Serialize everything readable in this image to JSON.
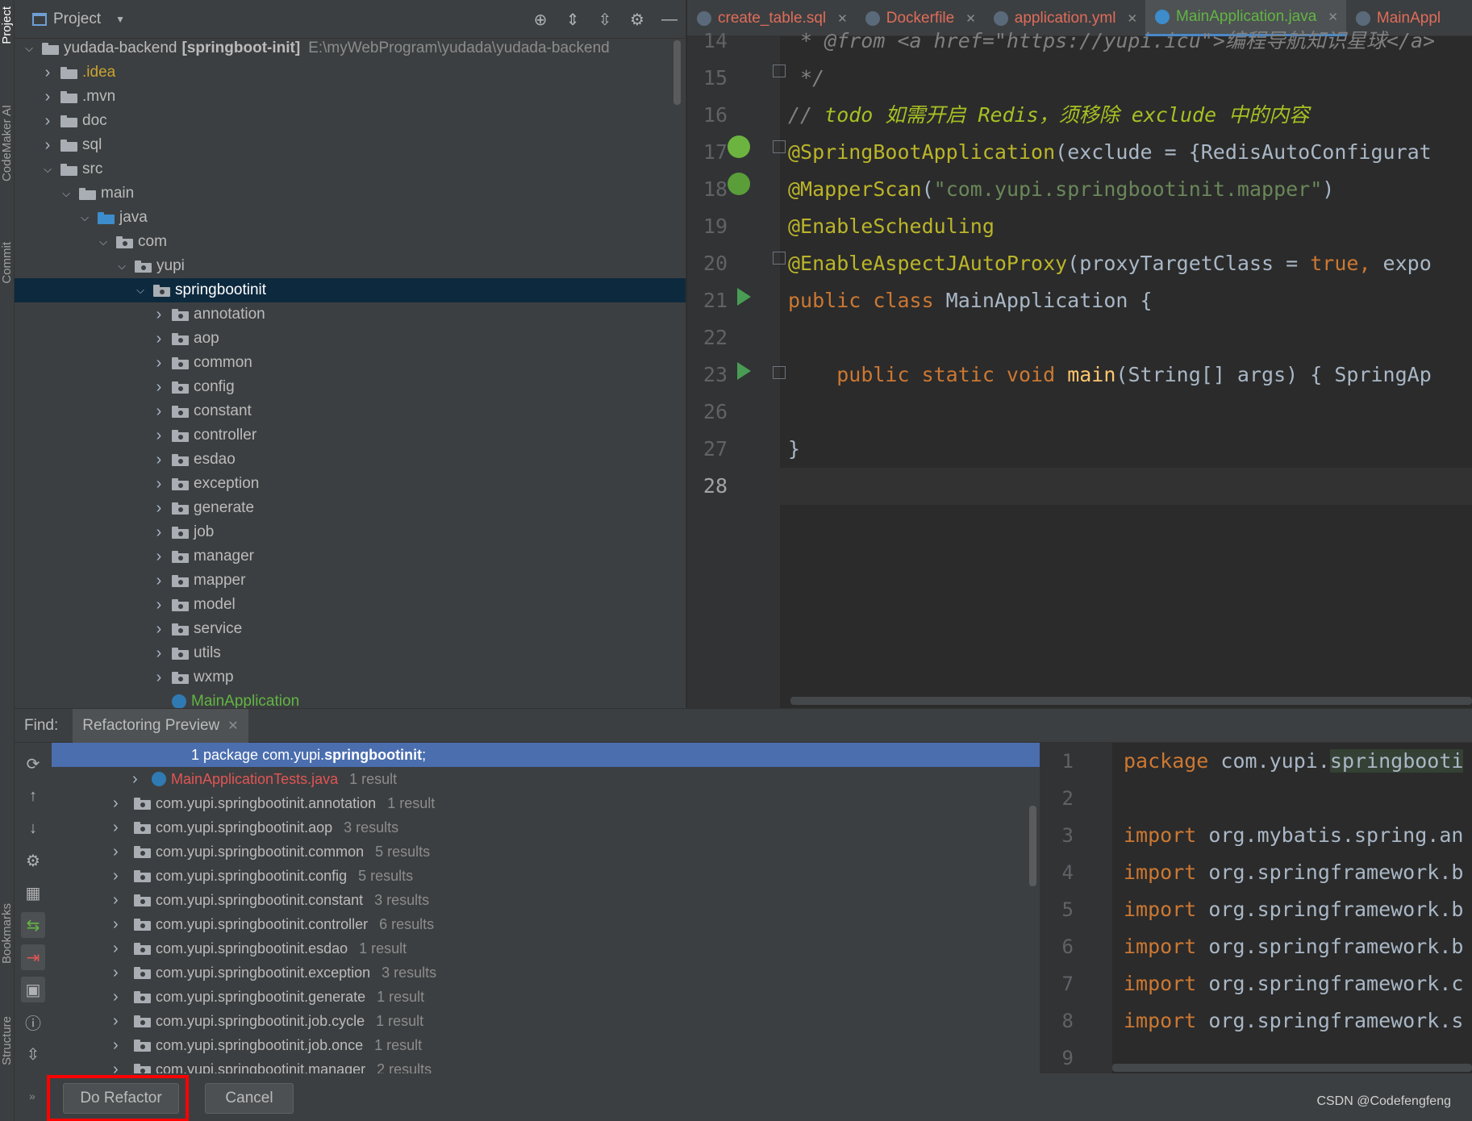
{
  "stripe": {
    "project_label": "Project",
    "codemaker_label": "CodeMaker AI",
    "commit_label": "Commit",
    "bookmarks_label": "Bookmarks",
    "structure_label": "Structure"
  },
  "project_panel": {
    "title": "Project",
    "root_name": "yudada-backend",
    "root_module": "[springboot-init]",
    "root_path": "E:\\myWebProgram\\yudada\\yudada-backend",
    "tree": [
      {
        "label": ".idea",
        "indent": 1,
        "expanded": false,
        "kind": "folder",
        "style": "yellow"
      },
      {
        "label": ".mvn",
        "indent": 1,
        "expanded": false,
        "kind": "folder"
      },
      {
        "label": "doc",
        "indent": 1,
        "expanded": false,
        "kind": "folder"
      },
      {
        "label": "sql",
        "indent": 1,
        "expanded": false,
        "kind": "folder"
      },
      {
        "label": "src",
        "indent": 1,
        "expanded": true,
        "kind": "folder"
      },
      {
        "label": "main",
        "indent": 2,
        "expanded": true,
        "kind": "folder"
      },
      {
        "label": "java",
        "indent": 3,
        "expanded": true,
        "kind": "folder-blue"
      },
      {
        "label": "com",
        "indent": 4,
        "expanded": true,
        "kind": "package"
      },
      {
        "label": "yupi",
        "indent": 5,
        "expanded": true,
        "kind": "package"
      },
      {
        "label": "springbootinit",
        "indent": 6,
        "expanded": true,
        "kind": "package",
        "selected": true
      },
      {
        "label": "annotation",
        "indent": 7,
        "expanded": false,
        "kind": "package"
      },
      {
        "label": "aop",
        "indent": 7,
        "expanded": false,
        "kind": "package"
      },
      {
        "label": "common",
        "indent": 7,
        "expanded": false,
        "kind": "package"
      },
      {
        "label": "config",
        "indent": 7,
        "expanded": false,
        "kind": "package"
      },
      {
        "label": "constant",
        "indent": 7,
        "expanded": false,
        "kind": "package"
      },
      {
        "label": "controller",
        "indent": 7,
        "expanded": false,
        "kind": "package"
      },
      {
        "label": "esdao",
        "indent": 7,
        "expanded": false,
        "kind": "package"
      },
      {
        "label": "exception",
        "indent": 7,
        "expanded": false,
        "kind": "package"
      },
      {
        "label": "generate",
        "indent": 7,
        "expanded": false,
        "kind": "package"
      },
      {
        "label": "job",
        "indent": 7,
        "expanded": false,
        "kind": "package"
      },
      {
        "label": "manager",
        "indent": 7,
        "expanded": false,
        "kind": "package"
      },
      {
        "label": "mapper",
        "indent": 7,
        "expanded": false,
        "kind": "package"
      },
      {
        "label": "model",
        "indent": 7,
        "expanded": false,
        "kind": "package"
      },
      {
        "label": "service",
        "indent": 7,
        "expanded": false,
        "kind": "package"
      },
      {
        "label": "utils",
        "indent": 7,
        "expanded": false,
        "kind": "package"
      },
      {
        "label": "wxmp",
        "indent": 7,
        "expanded": false,
        "kind": "package"
      },
      {
        "label": "MainApplication",
        "indent": 7,
        "expanded": null,
        "kind": "class",
        "style": "green"
      }
    ]
  },
  "editor": {
    "tabs": [
      {
        "label": "create_table.sql",
        "color": "#e06c5a",
        "active": false
      },
      {
        "label": "Dockerfile",
        "color": "#e06c5a",
        "active": false
      },
      {
        "label": "application.yml",
        "color": "#e06c5a",
        "active": false
      },
      {
        "label": "MainApplication.java",
        "color": "#62b543",
        "active": true
      },
      {
        "label": "MainAppl",
        "color": "#e06c5a",
        "active": false
      }
    ],
    "lines": [
      {
        "n": "14",
        "html_parts": [
          [
            "cmt",
            " * @from <a href=\"https://yupi.icu\">编程导航知识星球</a>"
          ]
        ]
      },
      {
        "n": "15",
        "html_parts": [
          [
            "cmt",
            " */"
          ]
        ]
      },
      {
        "n": "16",
        "html_parts": [
          [
            "cmt",
            "// "
          ],
          [
            "todo",
            "todo 如需开启 Redis，须移除 exclude 中的内容"
          ]
        ]
      },
      {
        "n": "17",
        "html_parts": [
          [
            "ann",
            "@SpringBootApplication"
          ],
          [
            "",
            "(exclude = {RedisAutoConfigurat"
          ]
        ]
      },
      {
        "n": "18",
        "html_parts": [
          [
            "ann",
            "@MapperScan"
          ],
          [
            "",
            "("
          ],
          [
            "str",
            "\"com.yupi.springbootinit.mapper\""
          ],
          [
            "",
            ")"
          ]
        ]
      },
      {
        "n": "19",
        "html_parts": [
          [
            "ann",
            "@EnableScheduling"
          ]
        ]
      },
      {
        "n": "20",
        "html_parts": [
          [
            "ann",
            "@EnableAspectJAutoProxy"
          ],
          [
            "",
            "(proxyTargetClass = "
          ],
          [
            "kw",
            "true"
          ],
          [
            "kw",
            ", "
          ],
          [
            "",
            "expo"
          ]
        ]
      },
      {
        "n": "21",
        "html_parts": [
          [
            "kw",
            "public class "
          ],
          [
            "",
            "MainApplication {"
          ]
        ]
      },
      {
        "n": "22",
        "html_parts": [
          [
            "",
            ""
          ]
        ]
      },
      {
        "n": "23",
        "html_parts": [
          [
            "",
            "    "
          ],
          [
            "kw",
            "public static void "
          ],
          [
            "fn",
            "main"
          ],
          [
            "",
            "(String[] args) { SpringAp"
          ]
        ]
      },
      {
        "n": "26",
        "html_parts": [
          [
            "",
            ""
          ]
        ]
      },
      {
        "n": "27",
        "html_parts": [
          [
            "",
            "}"
          ]
        ]
      },
      {
        "n": "28",
        "html_parts": [
          [
            "",
            ""
          ]
        ]
      }
    ]
  },
  "bottom": {
    "find_label": "Find:",
    "tab_label": "Refactoring Preview",
    "selected_row": {
      "prefix": "1 package com.yupi.",
      "bold": "springbootinit",
      "suffix": ";"
    },
    "rows": [
      {
        "label": "MainApplicationTests.java",
        "count": "1 result",
        "style": "red",
        "indent": "deep"
      },
      {
        "label": "com.yupi.springbootinit.annotation",
        "count": "1 result"
      },
      {
        "label": "com.yupi.springbootinit.aop",
        "count": "3 results"
      },
      {
        "label": "com.yupi.springbootinit.common",
        "count": "5 results"
      },
      {
        "label": "com.yupi.springbootinit.config",
        "count": "5 results"
      },
      {
        "label": "com.yupi.springbootinit.constant",
        "count": "3 results"
      },
      {
        "label": "com.yupi.springbootinit.controller",
        "count": "6 results"
      },
      {
        "label": "com.yupi.springbootinit.esdao",
        "count": "1 result"
      },
      {
        "label": "com.yupi.springbootinit.exception",
        "count": "3 results"
      },
      {
        "label": "com.yupi.springbootinit.generate",
        "count": "1 result"
      },
      {
        "label": "com.yupi.springbootinit.job.cycle",
        "count": "1 result"
      },
      {
        "label": "com.yupi.springbootinit.job.once",
        "count": "1 result"
      },
      {
        "label": "com.yupi.springbootinit.manager",
        "count": "2 results"
      }
    ],
    "preview_lines": [
      {
        "n": "1",
        "parts": [
          [
            "kw",
            "package "
          ],
          [
            "",
            "com.yupi."
          ],
          [
            "hl",
            "springbooti"
          ]
        ]
      },
      {
        "n": "2",
        "parts": [
          [
            "",
            ""
          ]
        ]
      },
      {
        "n": "3",
        "parts": [
          [
            "kw",
            "import "
          ],
          [
            "",
            "org.mybatis.spring.an"
          ]
        ]
      },
      {
        "n": "4",
        "parts": [
          [
            "kw",
            "import "
          ],
          [
            "",
            "org.springframework.b"
          ]
        ]
      },
      {
        "n": "5",
        "parts": [
          [
            "kw",
            "import "
          ],
          [
            "",
            "org.springframework.b"
          ]
        ]
      },
      {
        "n": "6",
        "parts": [
          [
            "kw",
            "import "
          ],
          [
            "",
            "org.springframework.b"
          ]
        ]
      },
      {
        "n": "7",
        "parts": [
          [
            "kw",
            "import "
          ],
          [
            "",
            "org.springframework.c"
          ]
        ]
      },
      {
        "n": "8",
        "parts": [
          [
            "kw",
            "import "
          ],
          [
            "",
            "org.springframework.s"
          ]
        ]
      },
      {
        "n": "9",
        "parts": [
          [
            "",
            ""
          ]
        ]
      }
    ],
    "do_refactor_label": "Do Refactor",
    "cancel_label": "Cancel",
    "watermark": "CSDN @Codefengfeng"
  }
}
